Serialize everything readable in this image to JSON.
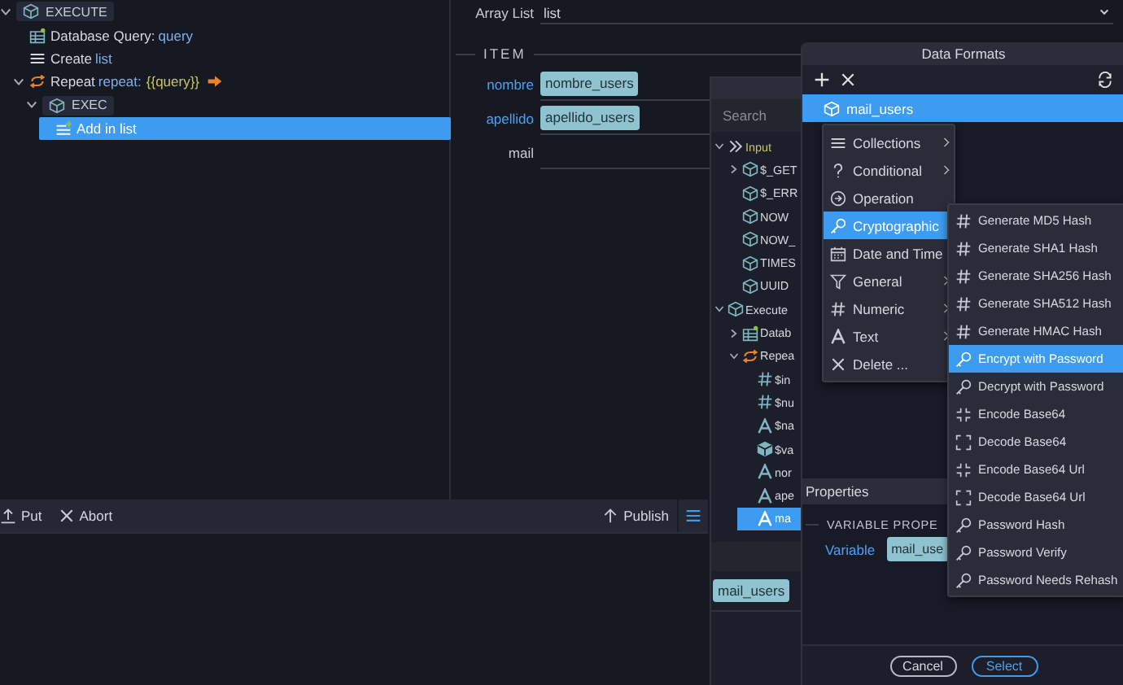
{
  "flow_tree": [
    {
      "label": "EXECUTE",
      "kind": "badge",
      "expanded": true,
      "selected": false,
      "children": [
        {
          "label": "Database Query:",
          "value": "query",
          "kind": "query",
          "selected": false
        },
        {
          "label": "Create",
          "value": "list",
          "kind": "list",
          "selected": false
        },
        {
          "label": "Repeat",
          "value": "repeat:",
          "expr": "{{query}}",
          "kind": "repeat",
          "expanded": true,
          "selected": false,
          "children": [
            {
              "label": "EXEC",
              "kind": "badge",
              "expanded": true,
              "selected": false,
              "children": [
                {
                  "label": "Add in list",
                  "kind": "add",
                  "selected": true
                }
              ]
            }
          ]
        }
      ]
    }
  ],
  "properties": {
    "array_list": {
      "label": "Array List",
      "value": "list"
    },
    "section": "ITEM",
    "fields": [
      {
        "label": "nombre",
        "value": "nombre_users",
        "bound": true
      },
      {
        "label": "apellido",
        "value": "apellido_users",
        "bound": true
      },
      {
        "label": "mail",
        "bound": false
      }
    ]
  },
  "toolbar": {
    "left": [
      {
        "label": "Put",
        "kind": "upload"
      },
      {
        "label": "Abort",
        "kind": "close"
      }
    ],
    "right": [
      {
        "label": "Publish",
        "kind": "arrowup"
      }
    ]
  },
  "picker": {
    "search_placeholder": "Search",
    "tree": [
      {
        "label": "Input",
        "kind": "chevrons",
        "expanded": true,
        "selected": false,
        "children": [
          {
            "label": "$_GET",
            "kind": "cube",
            "expanded": false,
            "selected": false
          },
          {
            "label": "$_ERR",
            "kind": "cube",
            "selected": false
          },
          {
            "label": "NOW",
            "kind": "cube",
            "selected": false
          },
          {
            "label": "NOW_",
            "kind": "cube",
            "selected": false
          },
          {
            "label": "TIMES",
            "kind": "cube",
            "selected": false
          },
          {
            "label": "UUID",
            "kind": "cube",
            "selected": false
          }
        ]
      },
      {
        "label": "Execute",
        "kind": "cube",
        "expanded": true,
        "selected": false,
        "children": [
          {
            "label": "Datab",
            "kind": "query",
            "expanded": false,
            "selected": false
          },
          {
            "label": "Repea",
            "kind": "repeat",
            "expanded": true,
            "selected": false,
            "children": [
              {
                "label": "$in",
                "kind": "hash",
                "selected": false
              },
              {
                "label": "$nu",
                "kind": "hash",
                "selected": false
              },
              {
                "label": "$na",
                "kind": "text",
                "selected": false
              },
              {
                "label": "$va",
                "kind": "cubefill",
                "selected": false
              },
              {
                "label": "nor",
                "kind": "text",
                "selected": false
              },
              {
                "label": "ape",
                "kind": "text",
                "selected": false
              },
              {
                "label": "ma",
                "kind": "text",
                "selected": true
              }
            ]
          }
        ]
      }
    ],
    "tag": "mail_users"
  },
  "data_formats": {
    "title": "Data Formats",
    "selected_item": "mail_users",
    "menu": [
      {
        "label": "Collections",
        "kind": "list",
        "submenu": true,
        "selected": false
      },
      {
        "label": "Conditional",
        "kind": "question",
        "submenu": true,
        "selected": false
      },
      {
        "label": "Operation",
        "kind": "operation",
        "submenu": false,
        "selected": false
      },
      {
        "label": "Cryptographic",
        "kind": "key",
        "submenu": true,
        "selected": true
      },
      {
        "label": "Date and Time",
        "kind": "calendar",
        "submenu": true,
        "selected": false
      },
      {
        "label": "General",
        "kind": "filter",
        "submenu": true,
        "selected": false
      },
      {
        "label": "Numeric",
        "kind": "hash",
        "submenu": true,
        "selected": false
      },
      {
        "label": "Text",
        "kind": "text",
        "submenu": true,
        "selected": false
      },
      {
        "label": "Delete ...",
        "kind": "close",
        "submenu": false,
        "selected": false
      }
    ],
    "submenu": [
      {
        "label": "Generate MD5 Hash",
        "kind": "hash",
        "selected": false
      },
      {
        "label": "Generate SHA1 Hash",
        "kind": "hash",
        "selected": false
      },
      {
        "label": "Generate SHA256 Hash",
        "kind": "hash",
        "selected": false
      },
      {
        "label": "Generate SHA512 Hash",
        "kind": "hash",
        "selected": false
      },
      {
        "label": "Generate HMAC Hash",
        "kind": "hash",
        "selected": false
      },
      {
        "label": "Encrypt with Password",
        "kind": "key",
        "selected": true
      },
      {
        "label": "Decrypt with Password",
        "kind": "key",
        "selected": false
      },
      {
        "label": "Encode Base64",
        "kind": "compress",
        "selected": false
      },
      {
        "label": "Decode Base64",
        "kind": "expand",
        "selected": false
      },
      {
        "label": "Encode Base64 Url",
        "kind": "compress",
        "selected": false
      },
      {
        "label": "Decode Base64 Url",
        "kind": "expand",
        "selected": false
      },
      {
        "label": "Password Hash",
        "kind": "key",
        "selected": false
      },
      {
        "label": "Password Verify",
        "kind": "key",
        "selected": false
      },
      {
        "label": "Password Needs Rehash",
        "kind": "key",
        "selected": false
      }
    ],
    "properties": {
      "title": "Properties",
      "section": "VARIABLE PROPE",
      "variable_label": "Variable",
      "variable_value": "mail_use"
    },
    "buttons": [
      {
        "label": "Cancel",
        "kind": "secondary"
      },
      {
        "label": "Select",
        "kind": "primary"
      }
    ]
  }
}
